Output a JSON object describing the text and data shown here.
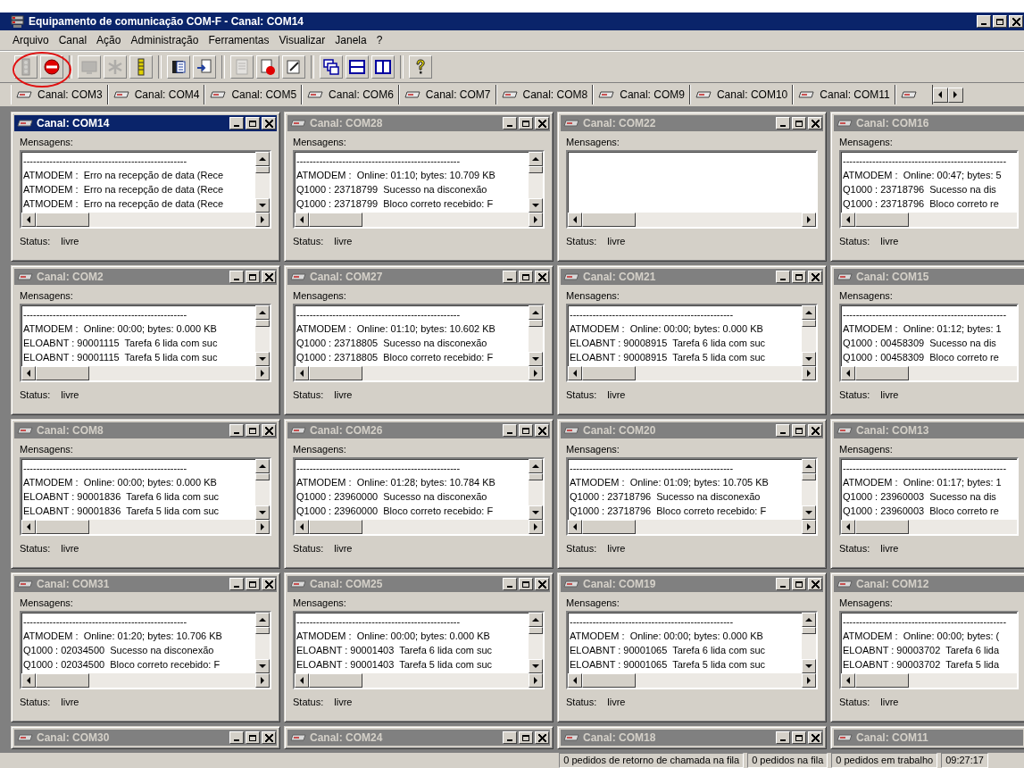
{
  "window": {
    "title": "Equipamento de comunicação COM-F - Canal: COM14"
  },
  "menu": [
    "Arquivo",
    "Canal",
    "Ação",
    "Administração",
    "Ferramentas",
    "Visualizar",
    "Janela",
    "?"
  ],
  "toolbar": [
    [
      {
        "kind": "traffic",
        "disabled": true
      },
      {
        "kind": "stop",
        "disabled": false
      }
    ],
    [
      {
        "kind": "monitor",
        "disabled": true
      },
      {
        "kind": "asterisk",
        "disabled": true
      },
      {
        "kind": "ladder",
        "disabled": false
      }
    ],
    [
      {
        "kind": "book",
        "disabled": false
      },
      {
        "kind": "export",
        "disabled": false
      }
    ],
    [
      {
        "kind": "doc",
        "disabled": true
      },
      {
        "kind": "docstop",
        "disabled": false
      },
      {
        "kind": "edit",
        "disabled": false
      }
    ],
    [
      {
        "kind": "cascade",
        "disabled": false
      },
      {
        "kind": "tilehz",
        "disabled": false
      },
      {
        "kind": "tilevt",
        "disabled": false
      }
    ],
    [
      {
        "kind": "help",
        "disabled": false
      }
    ]
  ],
  "tabs": [
    "Canal: COM3",
    "Canal: COM4",
    "Canal: COM5",
    "Canal: COM6",
    "Canal: COM7",
    "Canal: COM8",
    "Canal: COM9",
    "Canal: COM10",
    "Canal: COM11"
  ],
  "message_separator": "--------------------------------------------------",
  "windows": [
    {
      "title": "Canal: COM14",
      "active": true,
      "label": "Mensagens:",
      "status_label": "Status:",
      "status": "livre",
      "lines": [
        "ATMODEM :  Erro na recepção de data (Rece",
        "ATMODEM :  Erro na recepção de data (Rece",
        "ATMODEM :  Erro na recepção de data (Rece"
      ]
    },
    {
      "title": "Canal: COM28",
      "active": false,
      "label": "Mensagens:",
      "status_label": "Status:",
      "status": "livre",
      "lines": [
        "ATMODEM :  Online: 01:10; bytes: 10.709 KB",
        "Q1000 : 23718799  Sucesso na disconexão",
        "Q1000 : 23718799  Bloco correto recebido: F"
      ]
    },
    {
      "title": "Canal: COM22",
      "active": false,
      "label": "Mensagens:",
      "status_label": "Status:",
      "status": "livre"
    },
    {
      "title": "Canal: COM16",
      "active": false,
      "label": "Mensagens:",
      "status_label": "Status:",
      "status": "livre",
      "lines": [
        "ATMODEM :  Online: 00:47; bytes: 5",
        "Q1000 : 23718796  Sucesso na dis",
        "Q1000 : 23718796  Bloco correto re"
      ]
    },
    {
      "title": "Canal: COM2",
      "active": false,
      "label": "Mensagens:",
      "status_label": "Status:",
      "status": "livre",
      "lines": [
        "ATMODEM :  Online: 00:00; bytes: 0.000 KB",
        "ELOABNT : 90001115  Tarefa 6 lida com suc",
        "ELOABNT : 90001115  Tarefa 5 lida com suc"
      ]
    },
    {
      "title": "Canal: COM27",
      "active": false,
      "label": "Mensagens:",
      "status_label": "Status:",
      "status": "livre",
      "lines": [
        "ATMODEM :  Online: 01:10; bytes: 10.602 KB",
        "Q1000 : 23718805  Sucesso na disconexão",
        "Q1000 : 23718805  Bloco correto recebido: F"
      ]
    },
    {
      "title": "Canal: COM21",
      "active": false,
      "label": "Mensagens:",
      "status_label": "Status:",
      "status": "livre",
      "lines": [
        "ATMODEM :  Online: 00:00; bytes: 0.000 KB",
        "ELOABNT : 90008915  Tarefa 6 lida com suc",
        "ELOABNT : 90008915  Tarefa 5 lida com suc"
      ]
    },
    {
      "title": "Canal: COM15",
      "active": false,
      "label": "Mensagens:",
      "status_label": "Status:",
      "status": "livre",
      "lines": [
        "ATMODEM :  Online: 01:12; bytes: 1",
        "Q1000 : 00458309  Sucesso na dis",
        "Q1000 : 00458309  Bloco correto re"
      ]
    },
    {
      "title": "Canal: COM8",
      "active": false,
      "label": "Mensagens:",
      "status_label": "Status:",
      "status": "livre",
      "lines": [
        "ATMODEM :  Online: 00:00; bytes: 0.000 KB",
        "ELOABNT : 90001836  Tarefa 6 lida com suc",
        "ELOABNT : 90001836  Tarefa 5 lida com suc"
      ]
    },
    {
      "title": "Canal: COM26",
      "active": false,
      "label": "Mensagens:",
      "status_label": "Status:",
      "status": "livre",
      "lines": [
        "ATMODEM :  Online: 01:28; bytes: 10.784 KB",
        "Q1000 : 23960000  Sucesso na disconexão",
        "Q1000 : 23960000  Bloco correto recebido: F"
      ]
    },
    {
      "title": "Canal: COM20",
      "active": false,
      "label": "Mensagens:",
      "status_label": "Status:",
      "status": "livre",
      "lines": [
        "ATMODEM :  Online: 01:09; bytes: 10.705 KB",
        "Q1000 : 23718796  Sucesso na disconexão",
        "Q1000 : 23718796  Bloco correto recebido: F"
      ]
    },
    {
      "title": "Canal: COM13",
      "active": false,
      "label": "Mensagens:",
      "status_label": "Status:",
      "status": "livre",
      "lines": [
        "ATMODEM :  Online: 01:17; bytes: 1",
        "Q1000 : 23960003  Sucesso na dis",
        "Q1000 : 23960003  Bloco correto re"
      ]
    },
    {
      "title": "Canal: COM31",
      "active": false,
      "label": "Mensagens:",
      "status_label": "Status:",
      "status": "livre",
      "lines": [
        "ATMODEM :  Online: 01:20; bytes: 10.706 KB",
        "Q1000 : 02034500  Sucesso na disconexão",
        "Q1000 : 02034500  Bloco correto recebido: F"
      ]
    },
    {
      "title": "Canal: COM25",
      "active": false,
      "label": "Mensagens:",
      "status_label": "Status:",
      "status": "livre",
      "lines": [
        "ATMODEM :  Online: 00:00; bytes: 0.000 KB",
        "ELOABNT : 90001403  Tarefa 6 lida com suc",
        "ELOABNT : 90001403  Tarefa 5 lida com suc"
      ]
    },
    {
      "title": "Canal: COM19",
      "active": false,
      "label": "Mensagens:",
      "status_label": "Status:",
      "status": "livre",
      "lines": [
        "ATMODEM :  Online: 00:00; bytes: 0.000 KB",
        "ELOABNT : 90001065  Tarefa 6 lida com suc",
        "ELOABNT : 90001065  Tarefa 5 lida com suc"
      ]
    },
    {
      "title": "Canal: COM12",
      "active": false,
      "label": "Mensagens:",
      "status_label": "Status:",
      "status": "livre",
      "lines": [
        "ATMODEM :  Online: 00:00; bytes: (",
        "ELOABNT : 90003702  Tarefa 6 lida",
        "ELOABNT : 90003702  Tarefa 5 lida"
      ]
    }
  ],
  "partial_windows": [
    {
      "title": "Canal: COM30"
    },
    {
      "title": "Canal: COM24"
    },
    {
      "title": "Canal: COM18"
    },
    {
      "title": "Canal: COM11"
    }
  ],
  "status_bar": [
    "0 pedidos de retorno de chamada na fila",
    "0 pedidos na fila",
    "0 pedidos em trabalho",
    "09:27:17"
  ]
}
